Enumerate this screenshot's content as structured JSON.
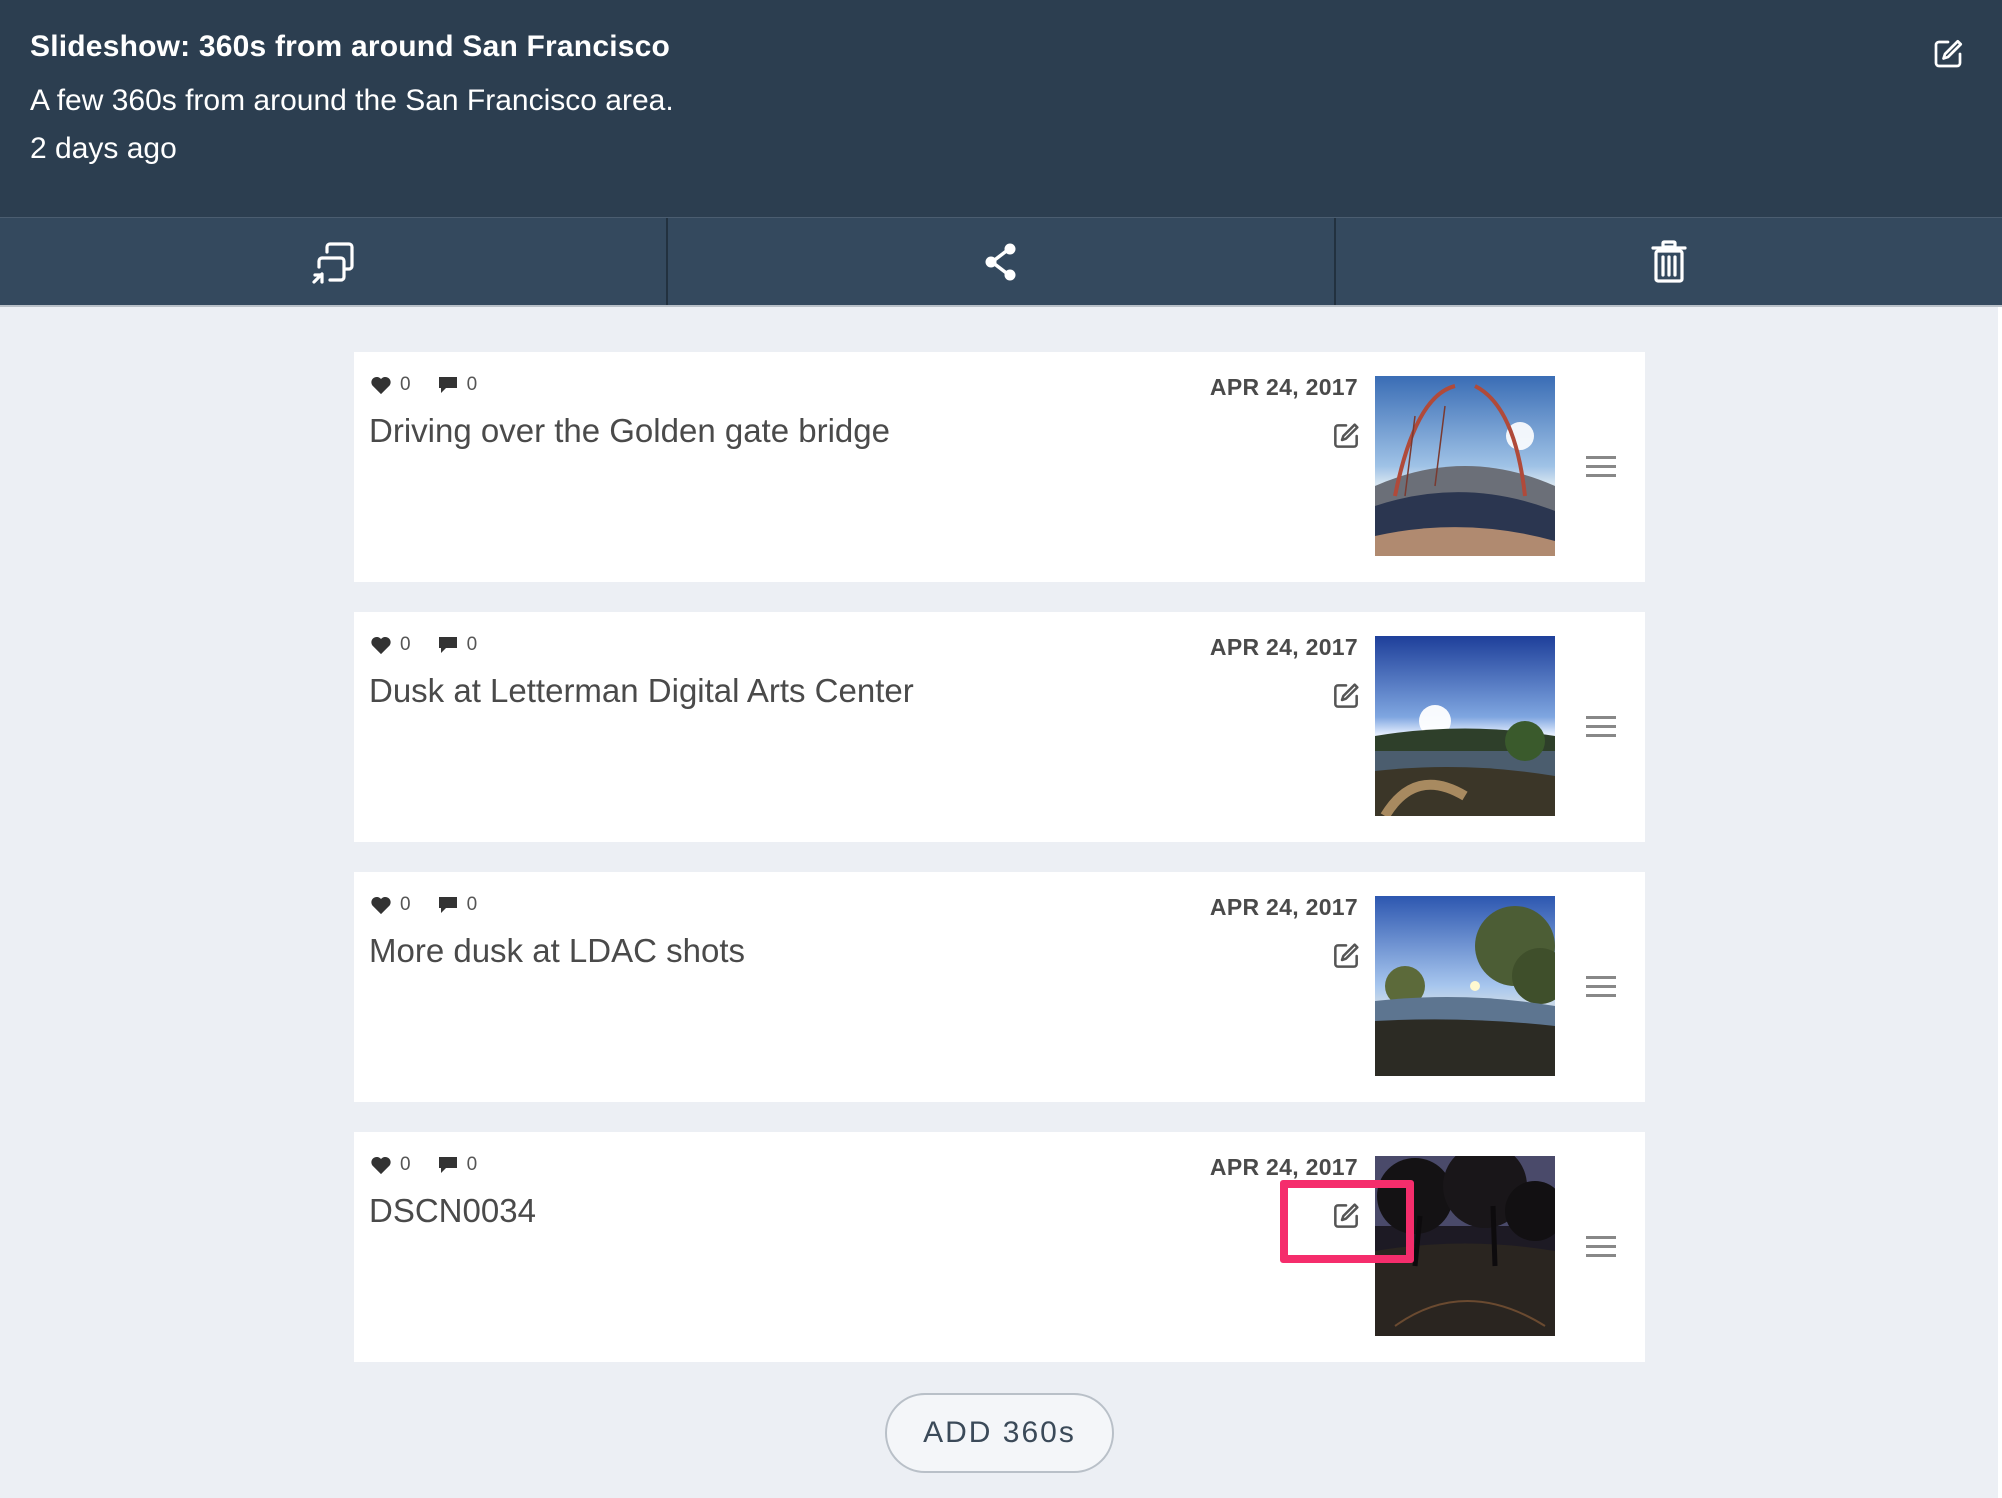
{
  "header": {
    "title": "Slideshow: 360s from around San Francisco",
    "description": "A few 360s from around the San Francisco area.",
    "time": "2 days ago",
    "edit_icon": "edit-icon"
  },
  "toolbar": {
    "items": [
      {
        "icon": "cast-icon"
      },
      {
        "icon": "share-icon"
      },
      {
        "icon": "trash-icon"
      }
    ]
  },
  "items": [
    {
      "likes": "0",
      "comments": "0",
      "title": "Driving over the Golden gate bridge",
      "date": "APR 24, 2017"
    },
    {
      "likes": "0",
      "comments": "0",
      "title": "Dusk at Letterman Digital Arts Center",
      "date": "APR 24, 2017"
    },
    {
      "likes": "0",
      "comments": "0",
      "title": "More dusk at LDAC shots",
      "date": "APR 24, 2017"
    },
    {
      "likes": "0",
      "comments": "0",
      "title": "DSCN0034",
      "date": "APR 24, 2017"
    }
  ],
  "add_button": {
    "label": "ADD 360s"
  },
  "colors": {
    "header_bg": "#2c3e50",
    "toolbar_bg": "#34495e",
    "page_bg": "#eceff4",
    "highlight": "#f52d6c"
  }
}
